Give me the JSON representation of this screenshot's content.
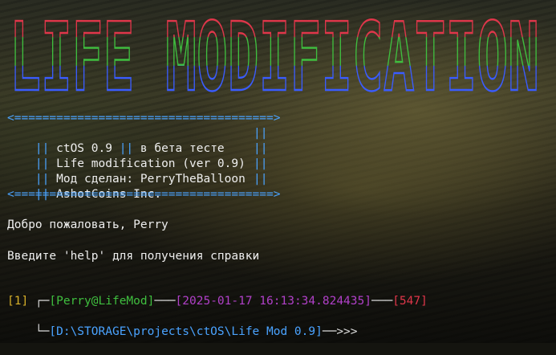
{
  "banner": {
    "text": "LIFE MODIFICATION",
    "colors": {
      "top": "#e0364a",
      "middle": "#3fbf3f",
      "bottom": "#3a5cff"
    }
  },
  "info_box": {
    "border_line": "<=====================================>",
    "rows": [
      {
        "left": "||",
        "text": " ctOS 0.9 ",
        "mid": "||",
        "text2": " в бета тесте",
        "right": "||"
      },
      {
        "left": "||",
        "text": " Life modification (ver 0.9)",
        "mid": "",
        "text2": "",
        "right": "||"
      },
      {
        "left": "||",
        "text": " Мод сделан: PerryTheBalloon",
        "mid": "",
        "text2": "",
        "right": "||"
      },
      {
        "left": "||",
        "text": " AshotCoins Inc.",
        "mid": "",
        "text2": "",
        "right": "||"
      }
    ]
  },
  "messages": {
    "welcome": "Добро пожаловать, Perry",
    "help_hint": "Введите 'help' для получения справки"
  },
  "prompt": {
    "corner_top": "┌─",
    "user_host": "[Perry@LifeMod]",
    "sep1": "───",
    "timestamp": "[2025-01-17 16:13:34.824435]",
    "sep2": "───",
    "counter": "[547]",
    "index": "[1]",
    "corner_bottom": "└─",
    "path": "[D:\\STORAGE\\projects\\ctOS\\Life Mod 0.9]",
    "arrow": "──>>>"
  }
}
